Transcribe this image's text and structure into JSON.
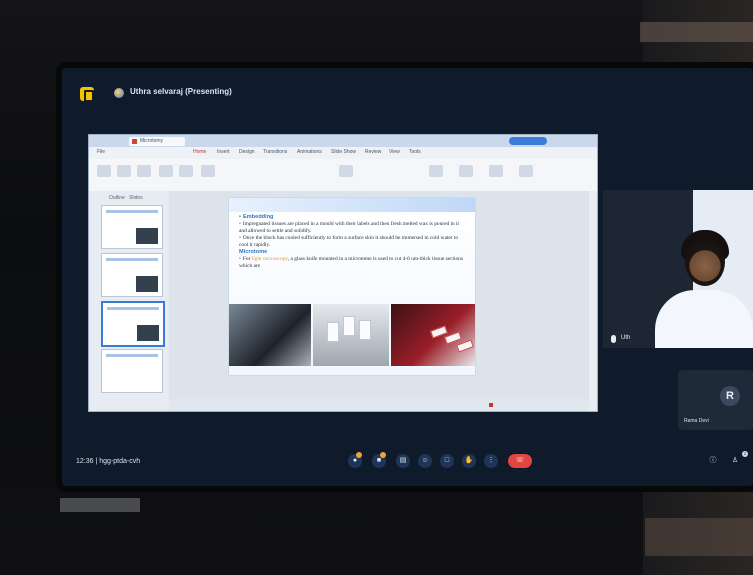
{
  "meet": {
    "presenter": "Uthra selvaraj (Presenting)",
    "time": "12:36",
    "separator": "|",
    "code": "hgg-ptda-cvh",
    "participants_count": "2"
  },
  "ppt": {
    "tab_label": "Microtomy",
    "menu": [
      "File",
      "Home",
      "Insert",
      "Design",
      "Transitions",
      "Animations",
      "Slide Show",
      "Review",
      "View",
      "Tools"
    ],
    "active_menu": "Home",
    "thumb_tabs": [
      "Outline",
      "Slides"
    ]
  },
  "slide": {
    "embedding_head": "Embedding",
    "line1": "Impregnated tissues are placed in a mould with their labels and then fresh melted wax is poured in it and allowed to settle and solidify.",
    "line2": "Once the block has cooled sufficiently to form a surface skin it should be immersed in cold water to cool it rapidly.",
    "microtome_head": "Microtome",
    "line3_pre": "For",
    "line3_hl": "light microscopy",
    "line3_post": ", a glass knife mounted in a microtome is used to cut 4-6 um-thick tissue sections which are"
  },
  "tiles": {
    "camera_name": "Uth",
    "second_initial": "R",
    "second_name": "Rama Devi"
  },
  "controls": [
    "mic",
    "camera",
    "captions",
    "emoji",
    "present",
    "raise-hand",
    "more",
    "end-call"
  ],
  "colors": {
    "end_call": "#e0453f",
    "logo": "#f2c300",
    "slide_heading": "#2e75c7",
    "highlight": "#e39b26"
  }
}
